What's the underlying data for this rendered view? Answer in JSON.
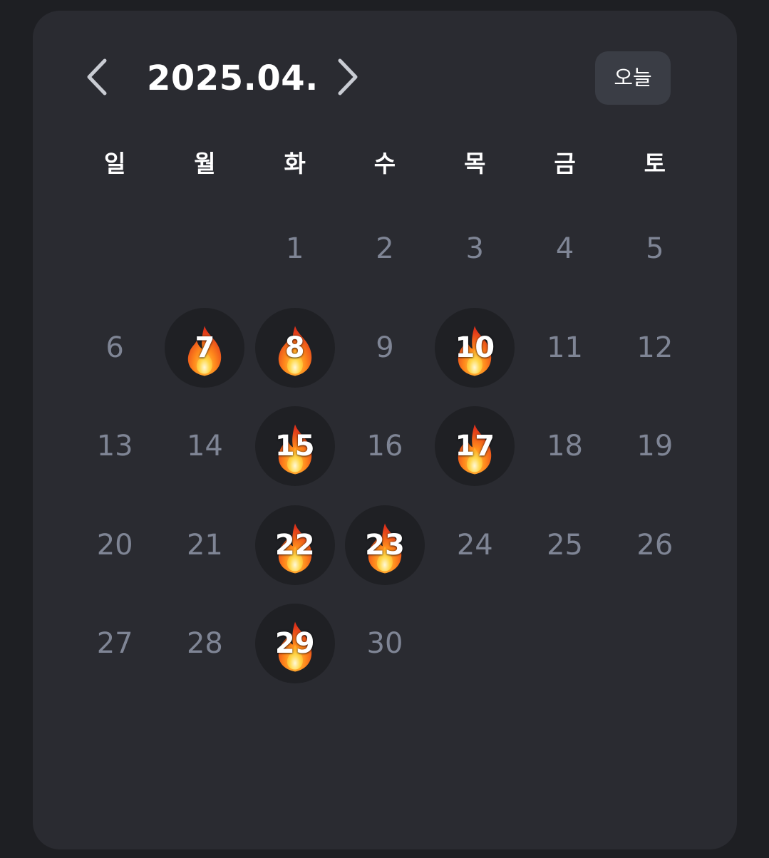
{
  "calendar": {
    "title": "2025.04.",
    "today_label": "오늘",
    "weekdays": [
      "일",
      "월",
      "화",
      "수",
      "목",
      "금",
      "토"
    ],
    "leading_blank_days": 2,
    "days": [
      {
        "label": "1",
        "streak": false
      },
      {
        "label": "2",
        "streak": false
      },
      {
        "label": "3",
        "streak": false
      },
      {
        "label": "4",
        "streak": false
      },
      {
        "label": "5",
        "streak": false
      },
      {
        "label": "6",
        "streak": false
      },
      {
        "label": "7",
        "streak": true
      },
      {
        "label": "8",
        "streak": true
      },
      {
        "label": "9",
        "streak": false
      },
      {
        "label": "10",
        "streak": true
      },
      {
        "label": "11",
        "streak": false
      },
      {
        "label": "12",
        "streak": false
      },
      {
        "label": "13",
        "streak": false
      },
      {
        "label": "14",
        "streak": false
      },
      {
        "label": "15",
        "streak": true
      },
      {
        "label": "16",
        "streak": false
      },
      {
        "label": "17",
        "streak": true
      },
      {
        "label": "18",
        "streak": false
      },
      {
        "label": "19",
        "streak": false
      },
      {
        "label": "20",
        "streak": false
      },
      {
        "label": "21",
        "streak": false
      },
      {
        "label": "22",
        "streak": true
      },
      {
        "label": "23",
        "streak": true
      },
      {
        "label": "24",
        "streak": false
      },
      {
        "label": "25",
        "streak": false
      },
      {
        "label": "26",
        "streak": false
      },
      {
        "label": "27",
        "streak": false
      },
      {
        "label": "28",
        "streak": false
      },
      {
        "label": "29",
        "streak": true
      },
      {
        "label": "30",
        "streak": false
      }
    ],
    "streak_icon": "fire-icon"
  },
  "colors": {
    "page_bg": "#1e1f23",
    "card_bg": "#2a2b31",
    "today_button_bg": "#3a3d45",
    "active_circle_bg": "#1f2024",
    "inactive_day_text": "#7f8595",
    "active_day_text": "#ffffff"
  },
  "icons": {
    "prev": "chevron-left-icon",
    "next": "chevron-right-icon",
    "streak": "fire-icon"
  }
}
